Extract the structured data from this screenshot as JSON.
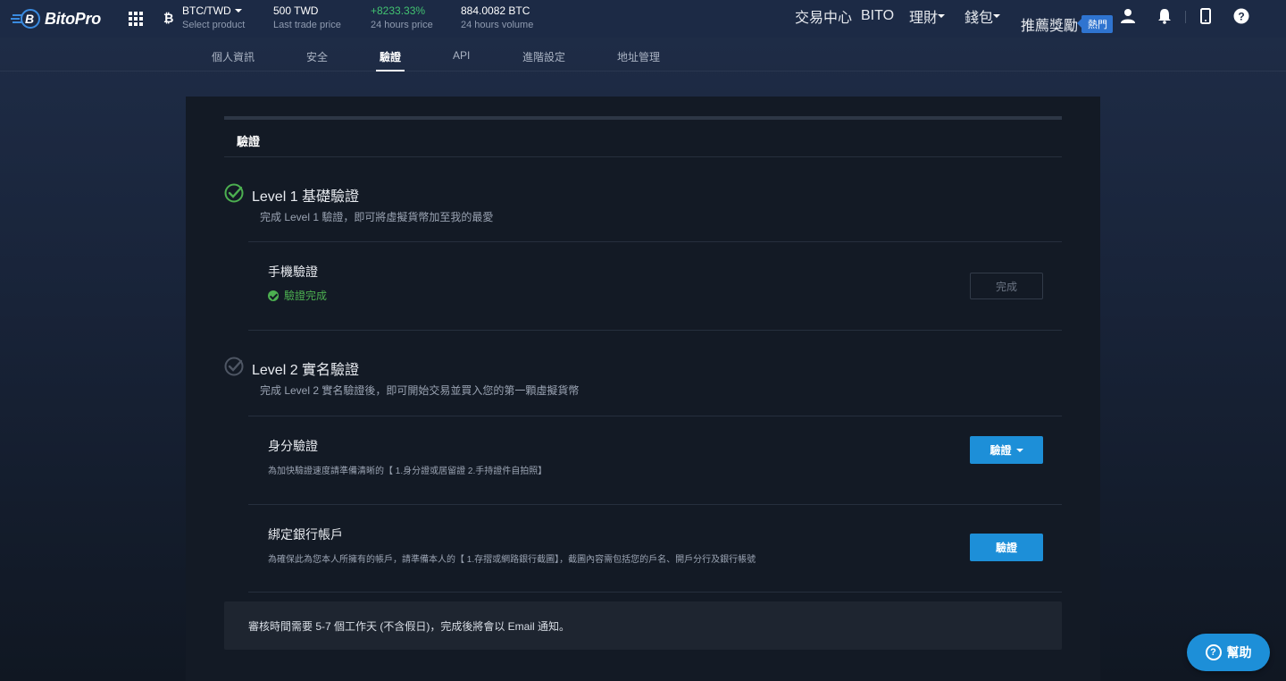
{
  "header": {
    "logo_text": "BitoPro",
    "pair": {
      "value": "BTC/TWD",
      "label": "Select product"
    },
    "last_price": {
      "value": "500 TWD",
      "label": "Last trade price"
    },
    "change": {
      "value": "+8233.33%",
      "label": "24 hours price"
    },
    "volume": {
      "value": "884.0082 BTC",
      "label": "24 hours volume"
    },
    "nav": {
      "trade_center": "交易中心",
      "bito": "BITO",
      "finance": "理財",
      "wallet": "錢包",
      "referral": "推薦獎勵",
      "hot_badge": "熱門"
    }
  },
  "tabs": [
    {
      "label": "個人資訊"
    },
    {
      "label": "安全"
    },
    {
      "label": "驗證"
    },
    {
      "label": "API"
    },
    {
      "label": "進階設定"
    },
    {
      "label": "地址管理"
    }
  ],
  "active_tab": "驗證",
  "panel": {
    "title": "驗證",
    "level1": {
      "title": "Level 1 基礎驗證",
      "desc": "完成 Level 1 驗證，即可將虛擬貨幣加至我的最愛",
      "phone": {
        "title": "手機驗證",
        "status": "驗證完成",
        "button": "完成"
      }
    },
    "level2": {
      "title": "Level 2 實名驗證",
      "desc": "完成 Level 2 實名驗證後，即可開始交易並買入您的第一顆虛擬貨幣",
      "identity": {
        "title": "身分驗證",
        "desc": "為加快驗證速度請準備清晰的【 1.身分證或居留證 2.手持證件自拍照】",
        "button": "驗證"
      },
      "bank": {
        "title": "綁定銀行帳戶",
        "desc": "為確保此為您本人所擁有的帳戶，請準備本人的【 1.存摺或網路銀行截圖】，截圖內容需包括您的戶名、開戶分行及銀行帳號",
        "button": "驗證"
      }
    },
    "note": "審核時間需要 5-7 個工作天 (不含假日)，完成後將會以 Email 通知。"
  },
  "help": {
    "label": "幫助"
  },
  "colors": {
    "accent_blue": "#1d8fd8",
    "success_green": "#4caf50",
    "price_green": "#42c271"
  }
}
